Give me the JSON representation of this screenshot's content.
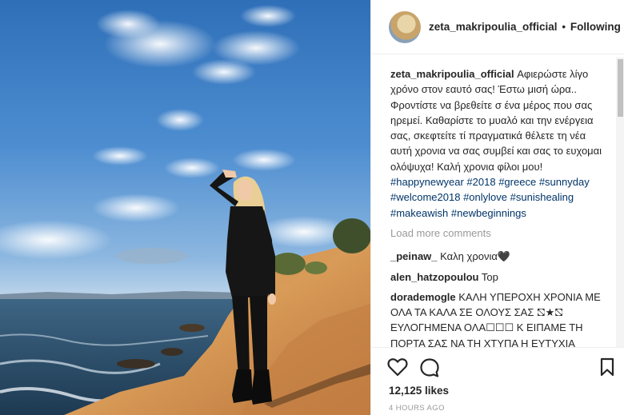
{
  "post": {
    "username": "zeta_makripoulia_official",
    "separator": "•",
    "follow_status": "Following",
    "caption_user": "zeta_makripoulia_official",
    "caption_text": "Αφιερώστε λίγο χρόνο στον εαυτό σας! Έστω μισή ώρα.. Φροντίστε να βρεθείτε σ ένα μέρος που σας ηρεμεί. Καθαρίστε το μυαλό και την ενέργεια σας, σκεφτείτε τί πραγματικά θέλετε τη νέα αυτή χρονια να σας συμβεί και σας το ευχομαι ολόψυχα! Καλή χρονια φίλοι μου!",
    "hashtags": [
      "#happynewyear",
      "#2018",
      "#greece",
      "#sunnyday",
      "#welcome2018",
      "#onlylove",
      "#sunishealing",
      "#makeawish",
      "#newbeginnings"
    ],
    "load_more": "Load more comments",
    "likes": "12,125 likes",
    "time": "4 HOURS AGO"
  },
  "comments": [
    {
      "user": "_peinaw_",
      "text": "Καλη χρονια🖤"
    },
    {
      "user": "alen_hatzopoulou",
      "text": "Top"
    },
    {
      "user": "dorademogle",
      "text": "ΚΑΛΗ ΥΠΕΡΟΧΗ ΧΡΟΝΙΑ ΜΕ ΟΛΑ ΤΑ ΚΑΛΑ ΣΕ ΟΛΟΥΣ ΣΑΣ ⛞★⛞ ΕΥΛΟΓΗΜΕΝΑ ΟΛΑ☐☐☐ Κ ΕΙΠΑΜΕ ΤΗ ΠΟΡΤΑ ΣΑΣ ΝΑ ΤΗ ΧΤΥΠΑ Η ΕΥΤΥΧΙΑ ΜΟΝΟΟΟΟΟΟ★🖤★🖤★🖤★🖤★🖤🖤"
    }
  ],
  "icons": {
    "like": "heart-outline-icon",
    "comment": "speech-bubble-icon",
    "save": "bookmark-icon"
  },
  "colors": {
    "hashtag": "#003569",
    "muted": "#999999",
    "text": "#262626"
  }
}
